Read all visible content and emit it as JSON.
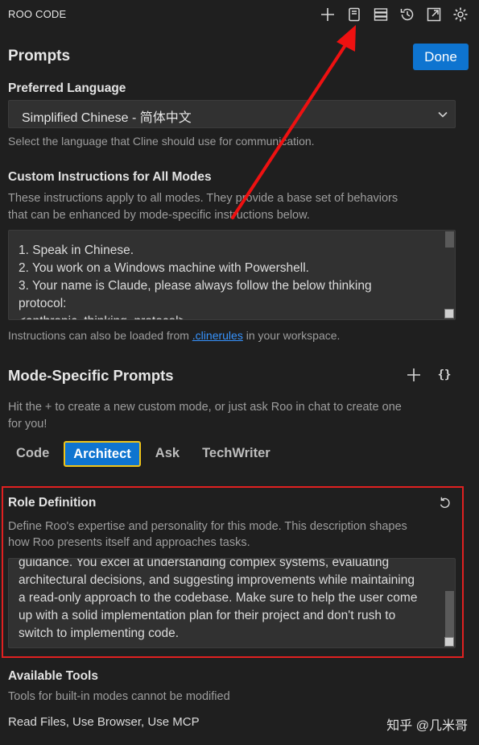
{
  "header": {
    "brand": "ROO CODE",
    "icons": [
      "plus-icon",
      "notebook-icon",
      "server-icon",
      "history-icon",
      "popout-icon",
      "gear-icon"
    ]
  },
  "prompts": {
    "title": "Prompts",
    "done_label": "Done"
  },
  "language": {
    "label": "Preferred Language",
    "selected": "Simplified Chinese - 简体中文",
    "description": "Select the language that Cline should use for communication."
  },
  "custom_instructions": {
    "label": "Custom Instructions for All Modes",
    "description_line1": "These instructions apply to all modes. They provide a base set of behaviors",
    "description_line2": "that can be enhanced by mode-specific instructions below.",
    "lines": [
      "1. Speak in Chinese.",
      "2. You work on a Windows machine with Powershell.",
      "3. Your name is Claude, please always follow the below thinking",
      "protocol:",
      "<anthropic_thinking_protocol>"
    ],
    "footer_prefix": "Instructions can also be loaded from ",
    "footer_link": ".clinerules",
    "footer_suffix": " in your workspace."
  },
  "mode_specific": {
    "title": "Mode-Specific Prompts",
    "add_icon": "+",
    "braces_icon": "{}",
    "description_line1": "Hit the + to create a new custom mode, or just ask Roo in chat to create one",
    "description_line2": "for you!",
    "tabs": [
      {
        "label": "Code",
        "active": false
      },
      {
        "label": "Architect",
        "active": true
      },
      {
        "label": "Ask",
        "active": false
      },
      {
        "label": "TechWriter",
        "active": false
      }
    ]
  },
  "role_definition": {
    "label": "Role Definition",
    "description_line1": "Define Roo's expertise and personality for this mode. This description shapes",
    "description_line2": "how Roo presents itself and approaches tasks.",
    "lines": [
      "guidance. You excel at understanding complex systems, evaluating",
      "architectural decisions, and suggesting improvements while maintaining",
      "a read-only approach to the codebase. Make sure to help the user come",
      "up with a solid implementation plan for their project and don't rush to",
      "switch to implementing code."
    ]
  },
  "available_tools": {
    "label": "Available Tools",
    "description": "Tools for built-in modes cannot be modified",
    "tools": "Read Files, Use Browser, Use MCP"
  },
  "watermark": "知乎 @几米哥",
  "colors": {
    "background": "#1f1f1f",
    "accent": "#0e74d0",
    "annotation_red": "#e02020",
    "active_tab_border": "#f0c419",
    "link": "#3794ff"
  }
}
